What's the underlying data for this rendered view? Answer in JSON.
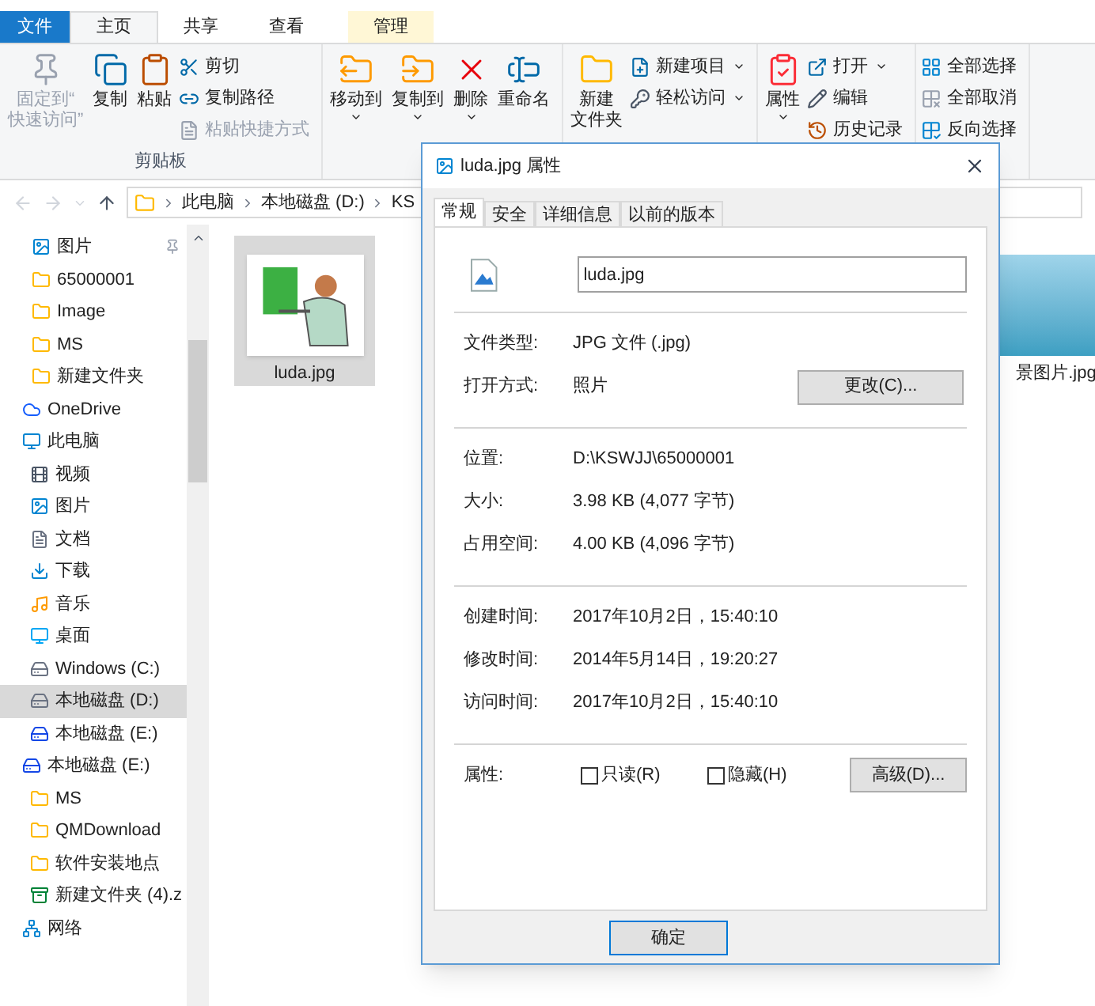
{
  "ribbon_tabs": [
    {
      "label": "文件",
      "kind": "file",
      "selected": false
    },
    {
      "label": "主页",
      "kind": "tab",
      "selected": true
    },
    {
      "label": "共享",
      "kind": "tab",
      "selected": false
    },
    {
      "label": "查看",
      "kind": "tab",
      "selected": false
    },
    {
      "label": "管理",
      "kind": "tab",
      "selected": false
    }
  ],
  "ribbon_groups": [
    {
      "label": "剪贴板",
      "items": [
        {
          "label": "固定到“",
          "label_line2": "快速访问”",
          "kind": "large",
          "disabled": true,
          "dropdown": false
        },
        {
          "label": "复制",
          "kind": "large",
          "disabled": false,
          "dropdown": false
        },
        {
          "label": "粘贴",
          "kind": "large",
          "disabled": false,
          "dropdown": false
        },
        {
          "label": "剪切",
          "kind": "small",
          "disabled": false,
          "dropdown": false
        },
        {
          "label": "复制路径",
          "kind": "small",
          "disabled": false,
          "dropdown": false
        },
        {
          "label": "粘贴快捷方式",
          "kind": "small",
          "disabled": true,
          "dropdown": false
        }
      ]
    },
    {
      "items": [
        {
          "label": "移动到",
          "kind": "large",
          "disabled": false,
          "dropdown": true
        },
        {
          "label": "复制到",
          "kind": "large",
          "disabled": false,
          "dropdown": true
        },
        {
          "label": "删除",
          "kind": "large",
          "disabled": false,
          "dropdown": true
        },
        {
          "label": "重命名",
          "kind": "large",
          "disabled": false,
          "dropdown": false
        }
      ]
    },
    {
      "items": [
        {
          "label": "新建",
          "label_line2": "文件夹",
          "kind": "large",
          "disabled": false,
          "dropdown": false
        },
        {
          "label": "新建项目",
          "kind": "small",
          "disabled": false,
          "dropdown": true
        },
        {
          "label": "轻松访问",
          "kind": "small",
          "disabled": false,
          "dropdown": true
        }
      ]
    },
    {
      "items": [
        {
          "label": "属性",
          "kind": "large",
          "disabled": false,
          "dropdown": true
        },
        {
          "label": "打开",
          "kind": "small",
          "disabled": false,
          "dropdown": true
        },
        {
          "label": "编辑",
          "kind": "small",
          "disabled": false,
          "dropdown": false
        },
        {
          "label": "历史记录",
          "kind": "small",
          "disabled": false,
          "dropdown": false
        }
      ]
    },
    {
      "items": [
        {
          "label": "全部选择",
          "kind": "small",
          "disabled": false,
          "dropdown": false
        },
        {
          "label": "全部取消",
          "kind": "small",
          "disabled": false,
          "dropdown": false
        },
        {
          "label": "反向选择",
          "kind": "small",
          "disabled": false,
          "dropdown": false
        }
      ]
    }
  ],
  "breadcrumbs": [
    "此电脑",
    "本地磁盘 (D:)",
    "KS"
  ],
  "nav": [
    {
      "label": "图片",
      "kind": "pictures",
      "pinned": true,
      "selected": false
    },
    {
      "label": "65000001",
      "kind": "folder",
      "pinned": false,
      "selected": false
    },
    {
      "label": "Image",
      "kind": "folder",
      "pinned": false,
      "selected": false
    },
    {
      "label": "MS",
      "kind": "folder",
      "pinned": false,
      "selected": false
    },
    {
      "label": "新建文件夹",
      "kind": "folder",
      "pinned": false,
      "selected": false
    },
    {
      "label": "OneDrive",
      "kind": "cloud",
      "pinned": false,
      "selected": false
    },
    {
      "label": "此电脑",
      "kind": "pc",
      "pinned": false,
      "selected": false,
      "children": [
        {
          "label": "视频",
          "kind": "video",
          "pinned": false,
          "selected": false
        },
        {
          "label": "图片",
          "kind": "pictures",
          "pinned": false,
          "selected": false
        },
        {
          "label": "文档",
          "kind": "docs",
          "pinned": false,
          "selected": false
        },
        {
          "label": "下载",
          "kind": "download",
          "pinned": false,
          "selected": false
        },
        {
          "label": "音乐",
          "kind": "music",
          "pinned": false,
          "selected": false
        },
        {
          "label": "桌面",
          "kind": "desktop",
          "pinned": false,
          "selected": false
        },
        {
          "label": "Windows (C:)",
          "kind": "drive",
          "pinned": false,
          "selected": false
        },
        {
          "label": "本地磁盘 (D:)",
          "kind": "drive",
          "pinned": false,
          "selected": true
        },
        {
          "label": "本地磁盘 (E:)",
          "kind": "netdrive",
          "pinned": false,
          "selected": false
        }
      ]
    },
    {
      "label": "本地磁盘 (E:)",
      "kind": "netdrive",
      "pinned": false,
      "selected": false,
      "children": [
        {
          "label": "MS",
          "kind": "folder",
          "pinned": false,
          "selected": false
        },
        {
          "label": "QMDownload",
          "kind": "folder",
          "pinned": false,
          "selected": false
        },
        {
          "label": "软件安装地点",
          "kind": "folder",
          "pinned": false,
          "selected": false
        },
        {
          "label": "新建文件夹 (4).z",
          "kind": "archive",
          "pinned": false,
          "selected": false
        }
      ]
    },
    {
      "label": "网络",
      "kind": "network",
      "pinned": false,
      "selected": false
    }
  ],
  "files": [
    {
      "name": "luda.jpg",
      "kind": "clipart",
      "selected": true
    },
    {
      "name": "景图片.jpg",
      "kind": "sea",
      "selected": false
    }
  ],
  "dialog": {
    "title": "luda.jpg 属性",
    "tabs": [
      {
        "label": "常规",
        "selected": true
      },
      {
        "label": "安全",
        "selected": false
      },
      {
        "label": "详细信息",
        "selected": false
      },
      {
        "label": "以前的版本",
        "selected": false
      }
    ],
    "file_name": "luda.jpg",
    "sections": [
      [
        {
          "label": "文件类型:",
          "value": "JPG 文件 (.jpg)"
        },
        {
          "label": "打开方式:",
          "value": "照片",
          "button": "更改(C)..."
        }
      ],
      [
        {
          "label": "位置:",
          "value": "D:\\KSWJJ\\65000001"
        },
        {
          "label": "大小:",
          "value": "3.98 KB (4,077 字节)"
        },
        {
          "label": "占用空间:",
          "value": "4.00 KB (4,096 字节)"
        }
      ],
      [
        {
          "label": "创建时间:",
          "value": "2017年10月2日，15:40:10"
        },
        {
          "label": "修改时间:",
          "value": "2014年5月14日，19:20:27"
        },
        {
          "label": "访问时间:",
          "value": "2017年10月2日，15:40:10"
        }
      ]
    ],
    "attributes": {
      "label": "属性:",
      "checkboxes": [
        {
          "label": "只读(R)",
          "checked": false
        },
        {
          "label": "隐藏(H)",
          "checked": false
        }
      ],
      "button": "高级(D)..."
    },
    "buttons": [
      "确定"
    ]
  }
}
